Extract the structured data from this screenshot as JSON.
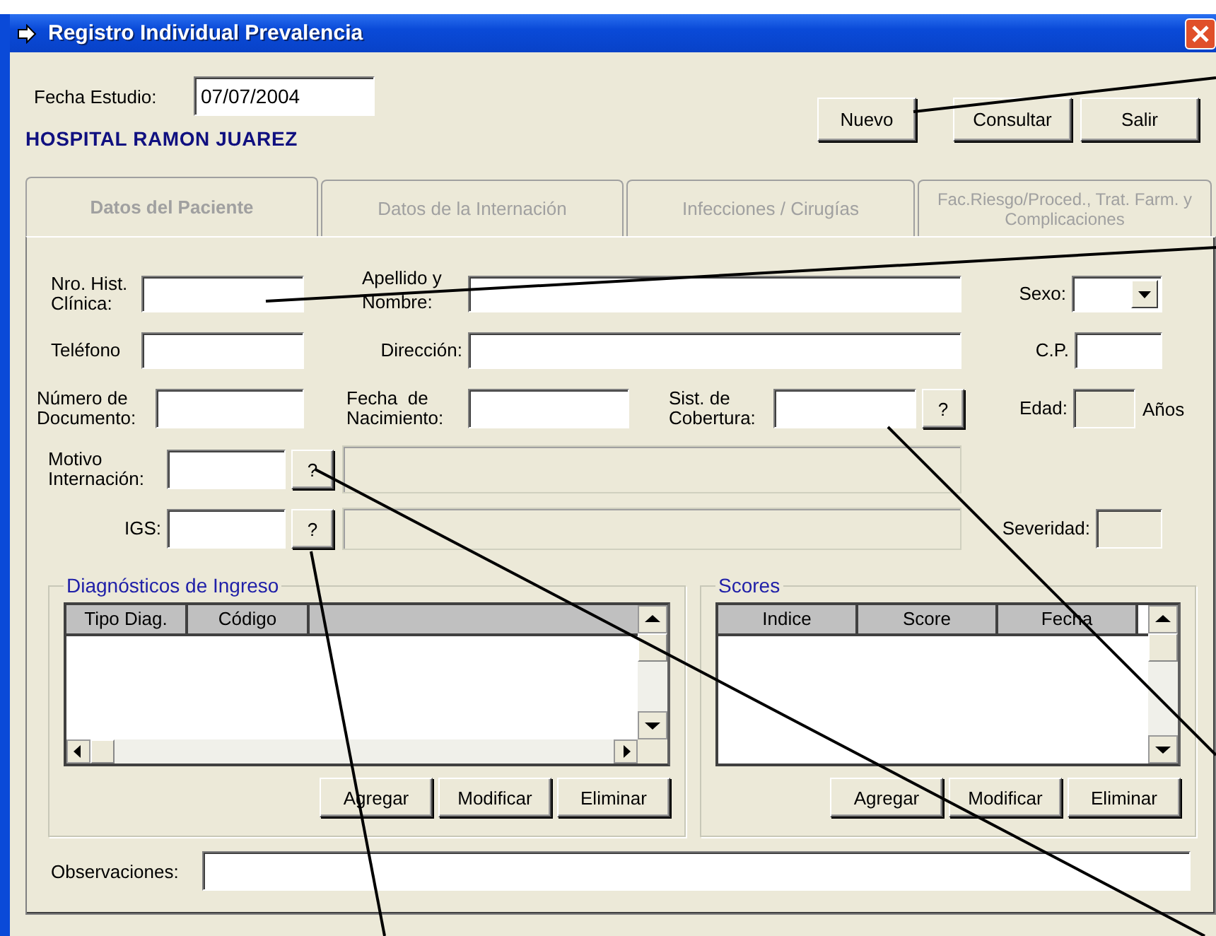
{
  "window": {
    "title": "Registro Individual Prevalencia"
  },
  "header": {
    "date_label": "Fecha Estudio:",
    "date_value": "07/07/2004",
    "hospital": "HOSPITAL RAMON JUAREZ"
  },
  "toolbar_buttons": [
    "Nuevo",
    "Consultar",
    "Salir"
  ],
  "tabs": [
    {
      "label": "Datos del Paciente",
      "selected": true
    },
    {
      "label": "Datos de la Internación",
      "selected": false
    },
    {
      "label": "Infecciones / Cirugías",
      "selected": false
    },
    {
      "label": "Fac.Riesgo/Proced., Trat. Farm. y Complicaciones",
      "selected": false
    }
  ],
  "patient_fields": [
    {
      "kind": "text",
      "label": "Nro. Hist. Clínica:",
      "disabled": false
    },
    {
      "kind": "text",
      "label": "Apellido y Nombre:",
      "disabled": false
    },
    {
      "kind": "combo",
      "label": "Sexo:"
    },
    {
      "kind": "text",
      "label": "Teléfono",
      "disabled": false
    },
    {
      "kind": "text",
      "label": "Dirección:",
      "disabled": false
    },
    {
      "kind": "text",
      "label": "C.P.",
      "disabled": false
    },
    {
      "kind": "text",
      "label": "Número de Documento:",
      "disabled": false
    },
    {
      "kind": "text",
      "label": "Fecha  de Nacimiento:",
      "disabled": false
    },
    {
      "kind": "lookup",
      "label": "Sist. de Cobertura:",
      "button": "?"
    },
    {
      "kind": "text",
      "label": "Edad:",
      "disabled": true,
      "unit": "Años"
    },
    {
      "kind": "lookup-desc",
      "label": "Motivo Internación:",
      "button": "?"
    },
    {
      "kind": "lookup-desc",
      "label": "IGS:",
      "button": "?"
    },
    {
      "kind": "text",
      "label": "Severidad:",
      "disabled": true
    }
  ],
  "groups": [
    {
      "title": "Diagnósticos de Ingreso",
      "columns": [
        "Tipo Diag.",
        "Código"
      ],
      "horizontal_scrollbar": true,
      "buttons": [
        "Agregar",
        "Modificar",
        "Eliminar"
      ]
    },
    {
      "title": "Scores",
      "columns": [
        "Indice",
        "Score",
        "Fecha"
      ],
      "horizontal_scrollbar": false,
      "buttons": [
        "Agregar",
        "Modificar",
        "Eliminar"
      ]
    }
  ],
  "observaciones": {
    "label": "Observaciones:"
  }
}
